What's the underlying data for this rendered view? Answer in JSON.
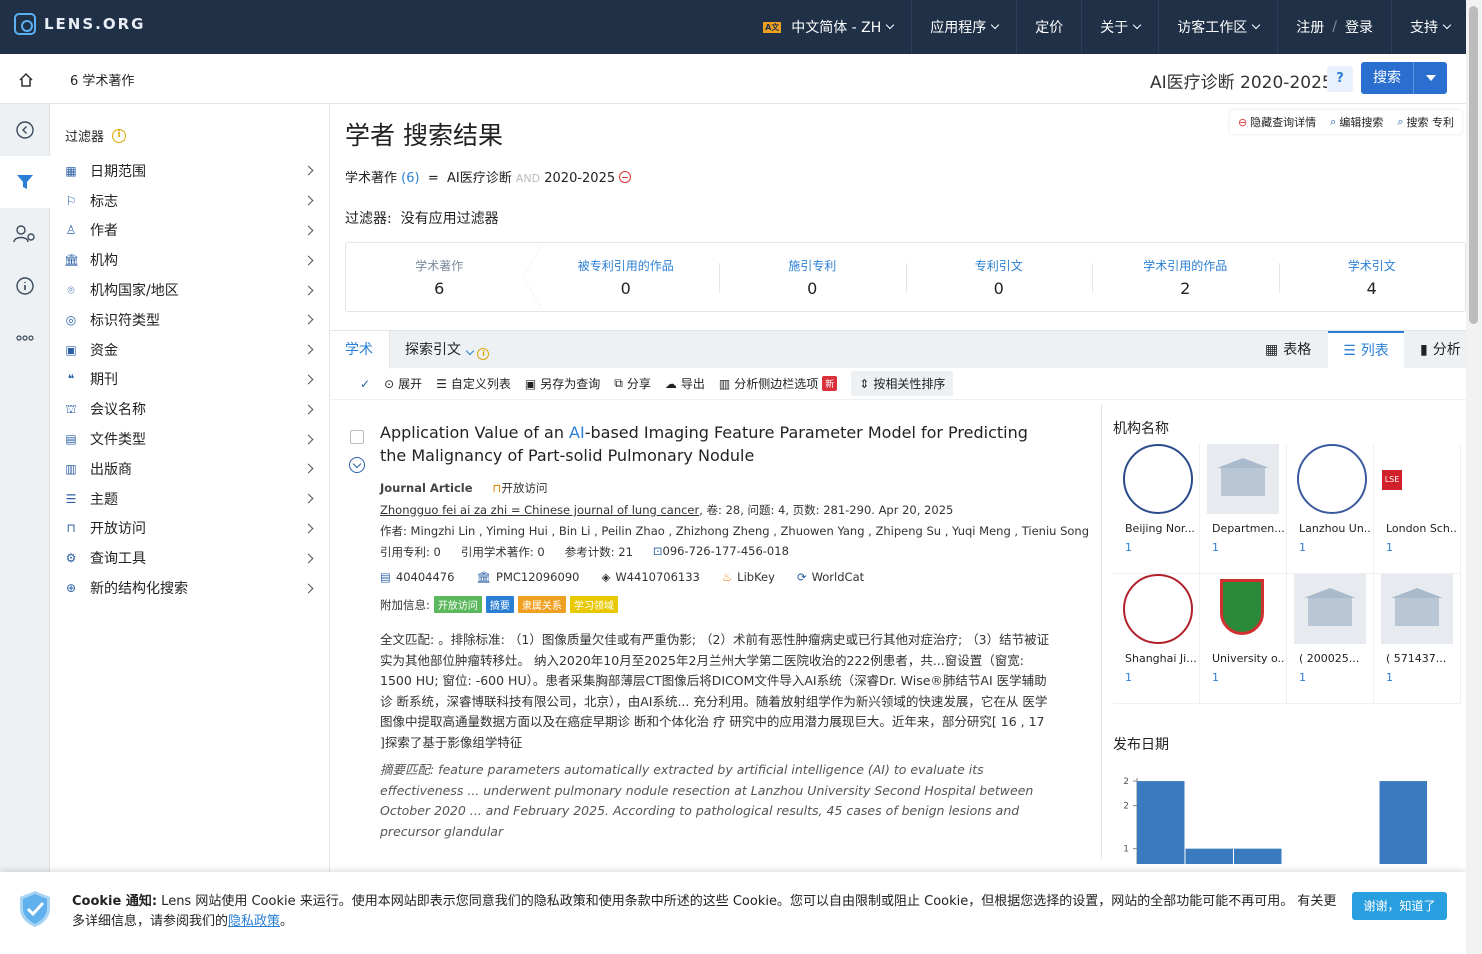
{
  "topbar": {
    "logo": "LENS.ORG",
    "nav": [
      {
        "label": "中文简体 - ZH",
        "flag": "A文"
      },
      {
        "label": "应用程序"
      },
      {
        "label": "定价"
      },
      {
        "label": "关于"
      },
      {
        "label": "访客工作区"
      }
    ],
    "register": "注册",
    "login": "登录",
    "support": "支持"
  },
  "subbar": {
    "breadcrumb": "6 学术著作",
    "query": "AI医疗诊断 2020-2025",
    "help": "?",
    "search_label": "搜索"
  },
  "filters": {
    "title": "过滤器",
    "items": [
      {
        "label": "日期范围",
        "icon": "calendar-icon",
        "glyph": "▦"
      },
      {
        "label": "标志",
        "icon": "flag-icon",
        "glyph": "⚐"
      },
      {
        "label": "作者",
        "icon": "person-icon",
        "glyph": "♙"
      },
      {
        "label": "机构",
        "icon": "institution-icon",
        "glyph": "🏛"
      },
      {
        "label": "机构国家/地区",
        "icon": "location-icon",
        "glyph": "⌾"
      },
      {
        "label": "标识符类型",
        "icon": "fingerprint-icon",
        "glyph": "◎"
      },
      {
        "label": "资金",
        "icon": "money-icon",
        "glyph": "▣"
      },
      {
        "label": "期刊",
        "icon": "quote-icon",
        "glyph": "❝"
      },
      {
        "label": "会议名称",
        "icon": "podium-icon",
        "glyph": "⛫"
      },
      {
        "label": "文件类型",
        "icon": "document-icon",
        "glyph": "▤"
      },
      {
        "label": "出版商",
        "icon": "books-icon",
        "glyph": "▥"
      },
      {
        "label": "主题",
        "icon": "list-icon",
        "glyph": "☰"
      },
      {
        "label": "开放访问",
        "icon": "unlock-icon",
        "glyph": "⊓"
      },
      {
        "label": "查询工具",
        "icon": "cogs-icon",
        "glyph": "⚙"
      },
      {
        "label": "新的结构化搜索",
        "icon": "search-plus-icon",
        "glyph": "⊕"
      }
    ]
  },
  "main": {
    "title": "学者 搜索结果",
    "links": {
      "hide": "隐藏查询详情",
      "edit": "编辑搜索",
      "patent": "搜索 专利"
    },
    "query_line": {
      "label": "学术著作",
      "count": "(6)",
      "eq": "=",
      "term1": "AI医疗诊断",
      "and": "AND",
      "term2": "2020-2025"
    },
    "filter_line": {
      "label": "过滤器:",
      "value": "没有应用过滤器"
    },
    "stats": [
      {
        "label": "学术著作",
        "value": "6"
      },
      {
        "label": "被专利引用的作品",
        "value": "0"
      },
      {
        "label": "施引专利",
        "value": "0"
      },
      {
        "label": "专利引文",
        "value": "0"
      },
      {
        "label": "学术引用的作品",
        "value": "2"
      },
      {
        "label": "学术引文",
        "value": "4"
      }
    ],
    "tabs": {
      "academic": "学术",
      "citing": "探索引文"
    },
    "views": {
      "table": "表格",
      "list": "列表",
      "analysis": "分析"
    },
    "toolbar": {
      "expand": "展开",
      "custom_list": "自定义列表",
      "save_query": "另存为查询",
      "share": "分享",
      "export": "导出",
      "analysis_sidebar": "分析侧边栏选项",
      "new_badge": "新",
      "sort": "按相关性排序"
    }
  },
  "result": {
    "title_pre": "Application Value of an ",
    "title_hl": "AI",
    "title_post": "-based Imaging Feature Parameter Model  for Predicting the Malignancy of Part-solid Pulmonary Nodule",
    "type": "Journal Article",
    "open_access": "开放访问",
    "journal": "Zhongguo fei ai za zhi = Chinese journal of lung cancer",
    "journal_rest": ", 卷: 28, 问题: 4, 页数: 281-290.  Apr 20, 2025",
    "authors": "作者: Mingzhi Lin , Yiming Hui , Bin Li , Peilin Zhao , Zhizhong Zheng , Zhuowen Yang , Zhipeng Su , Yuqi Meng , Tieniu Song",
    "cited_patents": "引用专利: 0",
    "cited_works": "引用学术著作: 0",
    "refs": "参考计数: 21",
    "lens_id": "096-726-177-456-018",
    "ids": {
      "pmid": "40404476",
      "pmcid": "PMC12096090",
      "openalex": "W4410706133",
      "libkey": "LibKey",
      "worldcat": "WorldCat"
    },
    "extra_label": "附加信息:",
    "tags": [
      "开放访问",
      "摘要",
      "隶属关系",
      "学习领域"
    ],
    "fulltext": "全文匹配: 。排除标准: （1）图像质量欠佳或有严重伪影; （2）术前有恶性肿瘤病史或已行其他对症治疗; （3）结节被证实为其他部位肿瘤转移灶。 纳入2020年10月至2025年2月兰州大学第二医院收治的222例患者，共...窗设置（窗宽: 1500 HU; 窗位: -600 HU）。患者采集胸部薄层CT图像后将DICOM文件导入AI系统（深睿Dr. Wise®肺结节AI 医学辅助 诊 断系统，深睿博联科技有限公司，北京），由AI系统... 充分利用。随着放射组学作为新兴领域的快速发展，它在从 医学图像中提取高通量数据方面以及在癌症早期诊 断和个体化治 疗 研究中的应用潜力展现巨大。近年来，部分研究[ 16 , 17 ]探索了基于影像组学特征",
    "abstract": "摘要匹配: feature parameters automatically extracted by artificial intelligence (AI) to evaluate its effectiveness ... underwent pulmonary nodule resection at Lanzhou University Second Hospital between October 2020 ... and February 2025. According to pathological results, 45 cases of benign lesions and precursor glandular"
  },
  "sidebar": {
    "inst_title": "机构名称",
    "institutions": [
      {
        "name": "Beijing Nor...",
        "count": "1"
      },
      {
        "name": "Departmen...",
        "count": "1"
      },
      {
        "name": "Lanzhou Un...",
        "count": "1"
      },
      {
        "name": "London Sch...",
        "count": "1"
      },
      {
        "name": "Shanghai Ji...",
        "count": "1"
      },
      {
        "name": "University o...",
        "count": "1"
      },
      {
        "name": "( 200025...",
        "count": "1"
      },
      {
        "name": "( 571437...",
        "count": "1"
      }
    ],
    "date_title": "发布日期"
  },
  "chart_data": {
    "type": "bar",
    "values": [
      2,
      1,
      1,
      0,
      0,
      2
    ],
    "ylim": [
      0.8,
      2.2
    ],
    "yticks": [
      "2",
      "2",
      "1"
    ],
    "color": "#3a7bbf"
  },
  "cookie": {
    "bold": "Cookie 通知:",
    "text": " Lens 网站使用 Cookie 来运行。使用本网站即表示您同意我们的隐私政策和使用条款中所述的这些 Cookie。您可以自由限制或阻止 Cookie，但根据您选择的设置，网站的全部功能可能不再可用。 有关更多详细信息，请参阅我们的",
    "link": "隐私政策",
    "end": "。",
    "button": "谢谢，知道了"
  }
}
